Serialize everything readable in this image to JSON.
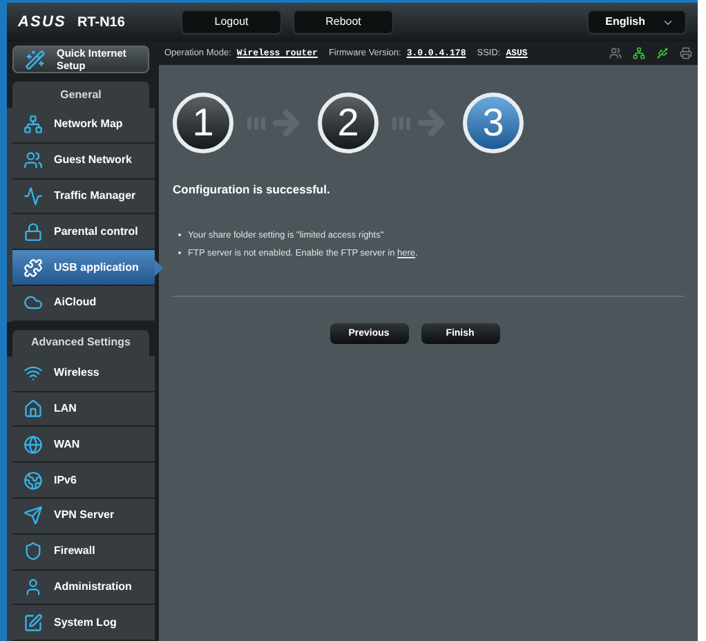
{
  "header": {
    "brand": "ASUS",
    "model": "RT-N16",
    "buttons": [
      "Logout",
      "Reboot"
    ],
    "language": "English"
  },
  "info": {
    "mode_label": "Operation Mode:",
    "mode": "Wireless router",
    "firmware_label": "Firmware Version:",
    "firmware": "3.0.0.4.178",
    "ssid_label": "SSID:",
    "ssid": "ASUS"
  },
  "status_icons": [
    {
      "kind": "clients",
      "active": false
    },
    {
      "kind": "network",
      "active": true
    },
    {
      "kind": "usb",
      "active": true
    },
    {
      "kind": "printer",
      "active": false
    }
  ],
  "quick_setup": "Quick Internet Setup",
  "sidebar": [
    {
      "title": "General",
      "items": [
        {
          "label": "Network Map",
          "selected": false
        },
        {
          "label": "Guest Network",
          "selected": false
        },
        {
          "label": "Traffic Manager",
          "selected": false
        },
        {
          "label": "Parental control",
          "selected": false
        },
        {
          "label": "USB application",
          "selected": true
        },
        {
          "label": "AiCloud",
          "selected": false
        }
      ]
    },
    {
      "title": "Advanced Settings",
      "items": [
        {
          "label": "Wireless",
          "selected": false
        },
        {
          "label": "LAN",
          "selected": false
        },
        {
          "label": "WAN",
          "selected": false
        },
        {
          "label": "IPv6",
          "selected": false
        },
        {
          "label": "VPN Server",
          "selected": false
        },
        {
          "label": "Firewall",
          "selected": false
        },
        {
          "label": "Administration",
          "selected": false
        },
        {
          "label": "System Log",
          "selected": false
        }
      ]
    }
  ],
  "steps": [
    {
      "label": "1",
      "selected": false
    },
    {
      "label": "2",
      "selected": false
    },
    {
      "label": "3",
      "selected": true
    }
  ],
  "message": "Configuration is successful.",
  "notes": [
    {
      "text": "Your share folder setting is \"limited access rights\""
    },
    {
      "text": "FTP server is not enabled. Enable the FTP server in ",
      "link": "here",
      "after": "."
    }
  ],
  "actions": [
    "Previous",
    "Finish"
  ]
}
